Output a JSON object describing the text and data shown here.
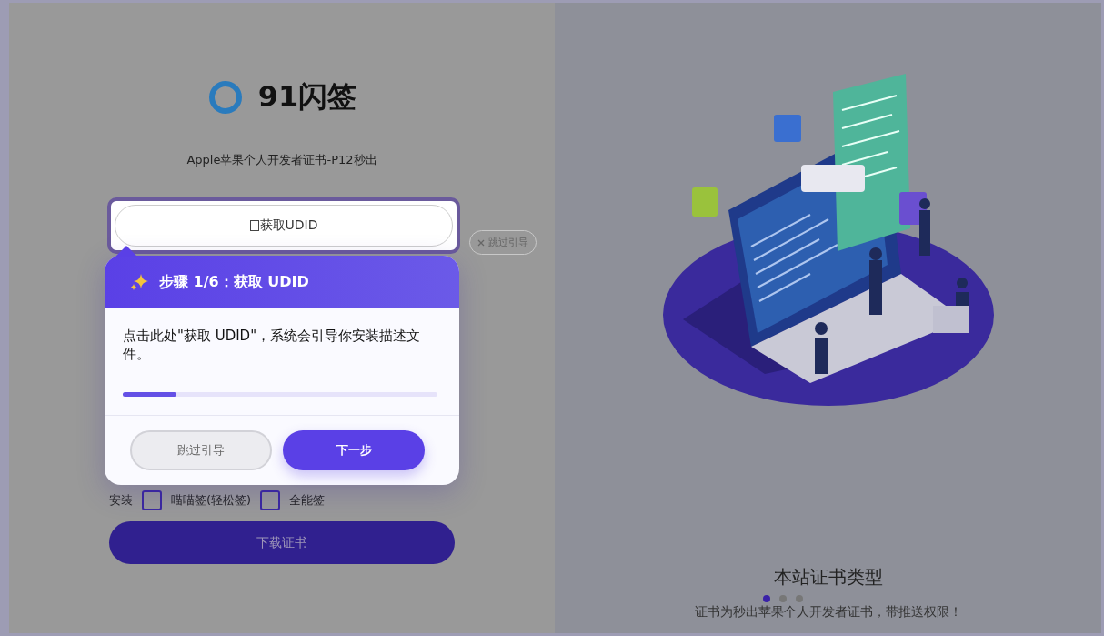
{
  "logo": {
    "name": "91闪签"
  },
  "subtitle": "Apple苹果个人开发者证书-P12秒出",
  "udid_button": {
    "label": "获取UDID"
  },
  "skip_link": {
    "label": "跳过引导"
  },
  "guide": {
    "title": "步骤 1/6：获取 UDID",
    "body": "点击此处\"获取 UDID\"，系统会引导你安装描述文件。",
    "level": 0.17,
    "buttons": [
      {
        "kind": "secondary",
        "label": "跳过引导"
      },
      {
        "kind": "primary",
        "label": "下一步"
      }
    ]
  },
  "install": {
    "label": "安装",
    "options": [
      {
        "label": "喵喵签(轻松签)",
        "checked": false
      },
      {
        "label": "全能签",
        "checked": false
      }
    ]
  },
  "download_button": {
    "label": "下载证书"
  },
  "carousel": {
    "title": "本站证书类型",
    "description": "证书为秒出苹果个人开发者证书，带推送权限！",
    "dots": [
      {
        "selected": true
      },
      {
        "selected": false
      },
      {
        "selected": false
      }
    ]
  }
}
